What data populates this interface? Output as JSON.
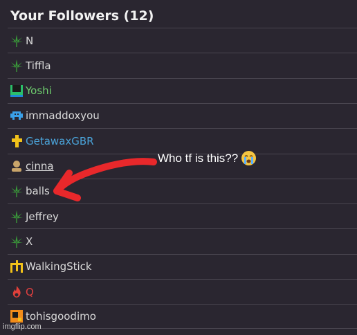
{
  "header": {
    "title": "Your Followers (12)"
  },
  "followers": [
    {
      "name": "N",
      "color": "#dadada",
      "icon": "weed-leaf-icon",
      "underline": false
    },
    {
      "name": "Tiffla",
      "color": "#dadada",
      "icon": "weed-leaf-icon",
      "underline": false
    },
    {
      "name": "Yoshi",
      "color": "#6fcf6f",
      "icon": "green-pixel-icon",
      "underline": false
    },
    {
      "name": "immaddoxyou",
      "color": "#dadada",
      "icon": "space-invader-icon",
      "underline": false
    },
    {
      "name": "GetawaxGBR",
      "color": "#4aa3d9",
      "icon": "yellow-cross-icon",
      "underline": false
    },
    {
      "name": "cinna",
      "color": "#dadada",
      "icon": "person-silhouette-icon",
      "underline": true
    },
    {
      "name": "balls",
      "color": "#dadada",
      "icon": "weed-leaf-icon",
      "underline": false
    },
    {
      "name": "Jeffrey",
      "color": "#dadada",
      "icon": "weed-leaf-icon",
      "underline": false
    },
    {
      "name": "X",
      "color": "#dadada",
      "icon": "weed-leaf-icon",
      "underline": false
    },
    {
      "name": "WalkingStick",
      "color": "#dadada",
      "icon": "walking-stick-icon",
      "underline": false
    },
    {
      "name": "Q",
      "color": "#e04040",
      "icon": "fire-icon",
      "underline": false
    },
    {
      "name": "tohisgoodimo",
      "color": "#dadada",
      "icon": "orange-square-icon",
      "underline": false
    }
  ],
  "annotation": {
    "text": "Who tf is this??",
    "emoji": "crying-face-icon"
  },
  "watermark": {
    "text": "imgflip.com"
  },
  "colors": {
    "background": "#2a2630",
    "arrow": "#e8282b",
    "leaf": "#3a9a3a"
  }
}
